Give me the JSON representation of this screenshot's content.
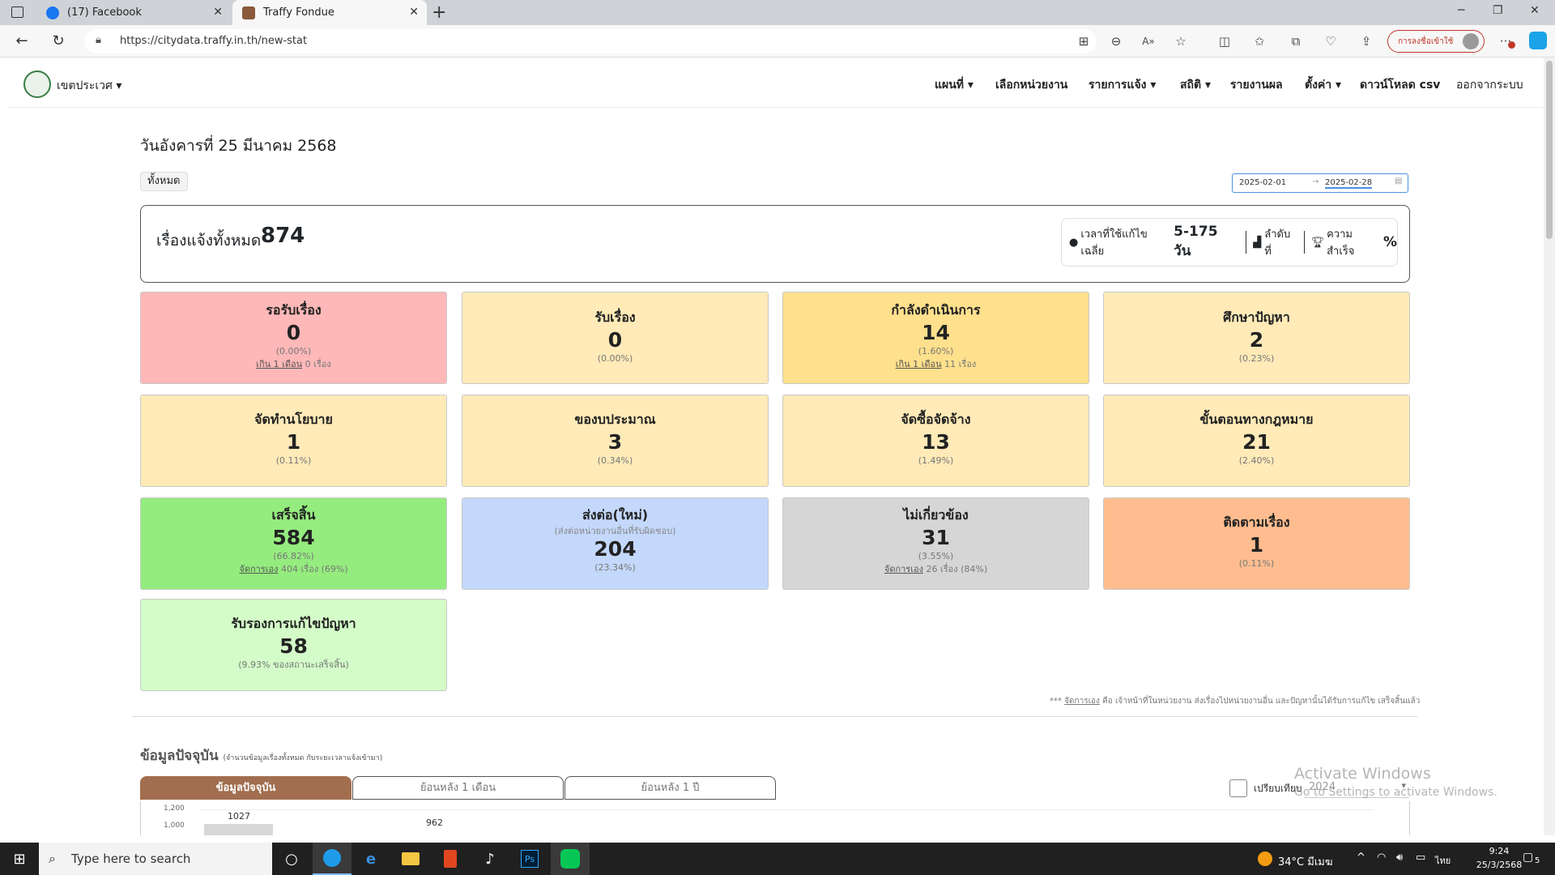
{
  "browser": {
    "tabs": [
      {
        "title": "(17) Facebook",
        "active": false,
        "icon": "facebook-icon",
        "color": "#1877f2"
      },
      {
        "title": "Traffy Fondue",
        "active": true,
        "icon": "traffy-icon",
        "color": "#8b5a3c"
      }
    ],
    "url": "https://citydata.traffy.in.th/new-stat",
    "signin_label": "การลงชื่อเข้าใช้"
  },
  "nav": {
    "district": "เขตประเวศ",
    "links": [
      "แผนที่",
      "เลือกหน่วยงาน",
      "รายการแจ้ง",
      "สถิติ",
      "รายงานผล",
      "ตั้งค่า",
      "ดาวน์โหลด csv",
      "ออกจากระบบ"
    ]
  },
  "date_title": "วันอังคารที่ 25 มีนาคม 2568",
  "all_button": "ทั้งหมด",
  "date_range": {
    "start": "2025-02-01",
    "end": "2025-02-28"
  },
  "summary": {
    "label": "เรื่องแจ้งทั้งหมด",
    "value": "874",
    "avg_time_label": "เวลาที่ใช้แก้ไขเฉลี่ย",
    "avg_time_value": "5-175 วัน",
    "rank_label": "ลำดับที่",
    "success_label": "ความสำเร็จ",
    "success_value": "%"
  },
  "cards": [
    {
      "title": "รอรับเรื่อง",
      "value": "0",
      "pct": "(0.00%)",
      "extra_link": "เกิน 1 เดือน",
      "extra_text": "0 เรื่อง",
      "color": "#ffb8b8"
    },
    {
      "title": "รับเรื่อง",
      "value": "0",
      "pct": "(0.00%)",
      "color": "#ffeab8"
    },
    {
      "title": "กำลังดำเนินการ",
      "value": "14",
      "pct": "(1.60%)",
      "extra_link": "เกิน 1 เดือน",
      "extra_text": "11 เรื่อง",
      "color": "#ffe08c"
    },
    {
      "title": "ศึกษาปัญหา",
      "value": "2",
      "pct": "(0.23%)",
      "color": "#ffeab8"
    },
    {
      "title": "จัดทำนโยบาย",
      "value": "1",
      "pct": "(0.11%)",
      "color": "#ffeab8"
    },
    {
      "title": "ของบประมาณ",
      "value": "3",
      "pct": "(0.34%)",
      "color": "#ffeab8"
    },
    {
      "title": "จัดซื้อจัดจ้าง",
      "value": "13",
      "pct": "(1.49%)",
      "color": "#ffeab8"
    },
    {
      "title": "ขั้นตอนทางกฎหมาย",
      "value": "21",
      "pct": "(2.40%)",
      "color": "#ffeab8"
    },
    {
      "title": "เสร็จสิ้น",
      "value": "584",
      "pct": "(66.82%)",
      "extra_link": "จัดการเอง",
      "extra_text": "404 เรื่อง (69%)",
      "color": "#95ec7e"
    },
    {
      "title": "ส่งต่อ(ใหม่)",
      "subtitle": "(ส่งต่อหน่วยงานอื่นที่รับผิดชอบ)",
      "value": "204",
      "pct": "(23.34%)",
      "color": "#c4d8fb"
    },
    {
      "title": "ไม่เกี่ยวข้อง",
      "value": "31",
      "pct": "(3.55%)",
      "extra_link": "จัดการเอง",
      "extra_text": "26 เรื่อง (84%)",
      "color": "#d6d6d6"
    },
    {
      "title": "ติดตามเรื่อง",
      "value": "1",
      "pct": "(0.11%)",
      "color": "#ffbd8f"
    },
    {
      "title": "รับรองการแก้ไขปัญหา",
      "value": "58",
      "pct": "(9.93% ของสถานะเสร็จสิ้น)",
      "color": "#d3fcc8"
    }
  ],
  "footnote": {
    "prefix": "***",
    "link": "จัดการเอง",
    "text": "คือ เจ้าหน้าที่ในหน่วยงาน ส่งเรื่องไปหน่วยงานอื่น และปัญหานั้นได้รับการแก้ไข เสร็จสิ้นแล้ว"
  },
  "current_section": {
    "title": "ข้อมูลปัจจุบัน",
    "note": "(จำนวนข้อมูลเรื่องทั้งหมด กับระยะเวลาแจ้งเข้ามา)",
    "tabs": [
      "ข้อมูลปัจจุบัน",
      "ย้อนหลัง 1 เดือน",
      "ย้อนหลัง 1 ปี"
    ],
    "compare_label": "เปรียบเทียบ",
    "year": "2024"
  },
  "chart_data": {
    "type": "bar",
    "y_tick_top": "1,200",
    "y_tick_second": "1,000",
    "visible_labels": [
      "1027",
      "962"
    ]
  },
  "watermark": {
    "line1": "Activate Windows",
    "line2": "Go to Settings to activate Windows."
  },
  "taskbar": {
    "search_placeholder": "Type here to search",
    "weather": "34°C มีเมฆ",
    "lang": "ไทย",
    "time": "9:24",
    "date": "25/3/2568",
    "notifications": "5"
  }
}
